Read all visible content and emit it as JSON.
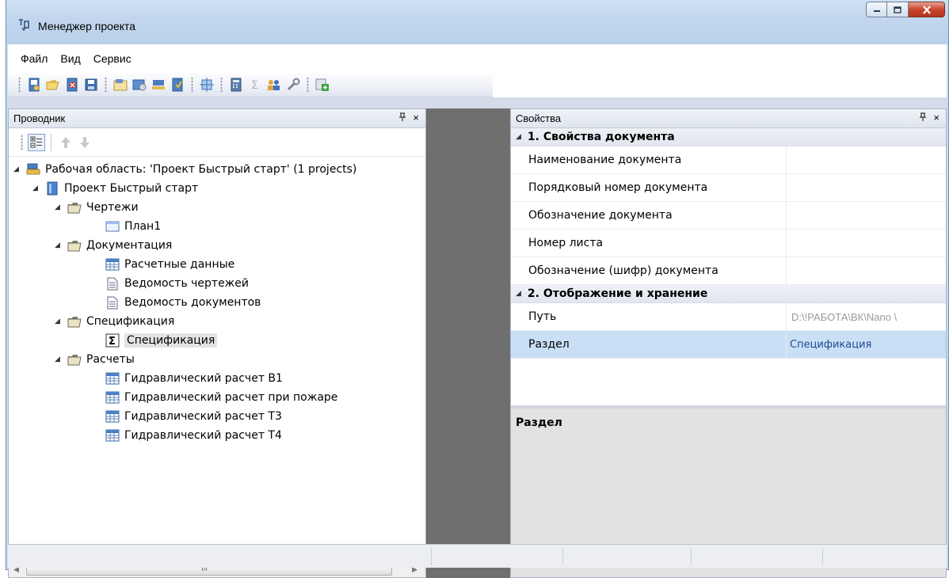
{
  "window": {
    "title": "Менеджер проекта",
    "controls": [
      "minimize",
      "maximize",
      "close"
    ]
  },
  "menu": {
    "items": [
      "Файл",
      "Вид",
      "Сервис"
    ]
  },
  "toolbar": {
    "buttons": [
      "new-project-icon",
      "open-folder-icon",
      "close-project-icon",
      "save-icon",
      "properties-icon",
      "settings-icon",
      "network-icon",
      "report-icon",
      "layout-icon",
      "calculator-icon",
      "sum-icon",
      "users-icon",
      "tools-icon",
      "export-icon"
    ]
  },
  "explorer": {
    "title": "Проводник",
    "pin": "ᚙ",
    "close": "×",
    "tree": [
      {
        "label": "Рабочая область: 'Проект Быстрый старт' (1 projects)",
        "icon": "workspace-icon",
        "level": 0,
        "expanded": true
      },
      {
        "label": "Проект Быстрый старт",
        "icon": "project-icon",
        "level": 1,
        "expanded": true
      },
      {
        "label": "Чертежи",
        "icon": "folder-icon",
        "level": 2,
        "expanded": true
      },
      {
        "label": "План1",
        "icon": "plan-icon",
        "level": 3
      },
      {
        "label": "Документация",
        "icon": "folder-icon",
        "level": 2,
        "expanded": true
      },
      {
        "label": "Расчетные данные",
        "icon": "table-icon",
        "level": 3
      },
      {
        "label": "Ведомость чертежей",
        "icon": "document-icon",
        "level": 3
      },
      {
        "label": "Ведомость документов",
        "icon": "document-icon",
        "level": 3
      },
      {
        "label": "Спецификация",
        "icon": "folder-icon",
        "level": 2,
        "expanded": true
      },
      {
        "label": "Спецификация",
        "icon": "sigma-icon",
        "level": 3,
        "selected": true
      },
      {
        "label": "Расчеты",
        "icon": "folder-icon",
        "level": 2,
        "expanded": true
      },
      {
        "label": "Гидравлический расчет В1",
        "icon": "table-icon",
        "level": 3
      },
      {
        "label": "Гидравлический расчет при пожаре",
        "icon": "table-icon",
        "level": 3
      },
      {
        "label": "Гидравлический расчет Т3",
        "icon": "table-icon",
        "level": 3
      },
      {
        "label": "Гидравлический расчет Т4",
        "icon": "table-icon",
        "level": 3
      }
    ],
    "scroll_grip": "III"
  },
  "properties": {
    "title": "Свойства",
    "pin": "ᚙ",
    "close": "×",
    "groups": [
      {
        "label": "1. Свойства документа",
        "rows": [
          {
            "name": "Наименование документа",
            "value": ""
          },
          {
            "name": "Порядковый номер документа",
            "value": ""
          },
          {
            "name": "Обозначение документа",
            "value": ""
          },
          {
            "name": "Номер листа",
            "value": ""
          },
          {
            "name": "Обозначение (шифр) документа",
            "value": ""
          }
        ]
      },
      {
        "label": "2. Отображение и хранение",
        "rows": [
          {
            "name": "Путь",
            "value": "D:\\!РАБОТА\\ВК\\Nano \\",
            "greyed": true
          },
          {
            "name": "Раздел",
            "value": "Спецификация",
            "selected": true
          }
        ]
      }
    ],
    "description_title": "Раздел"
  }
}
